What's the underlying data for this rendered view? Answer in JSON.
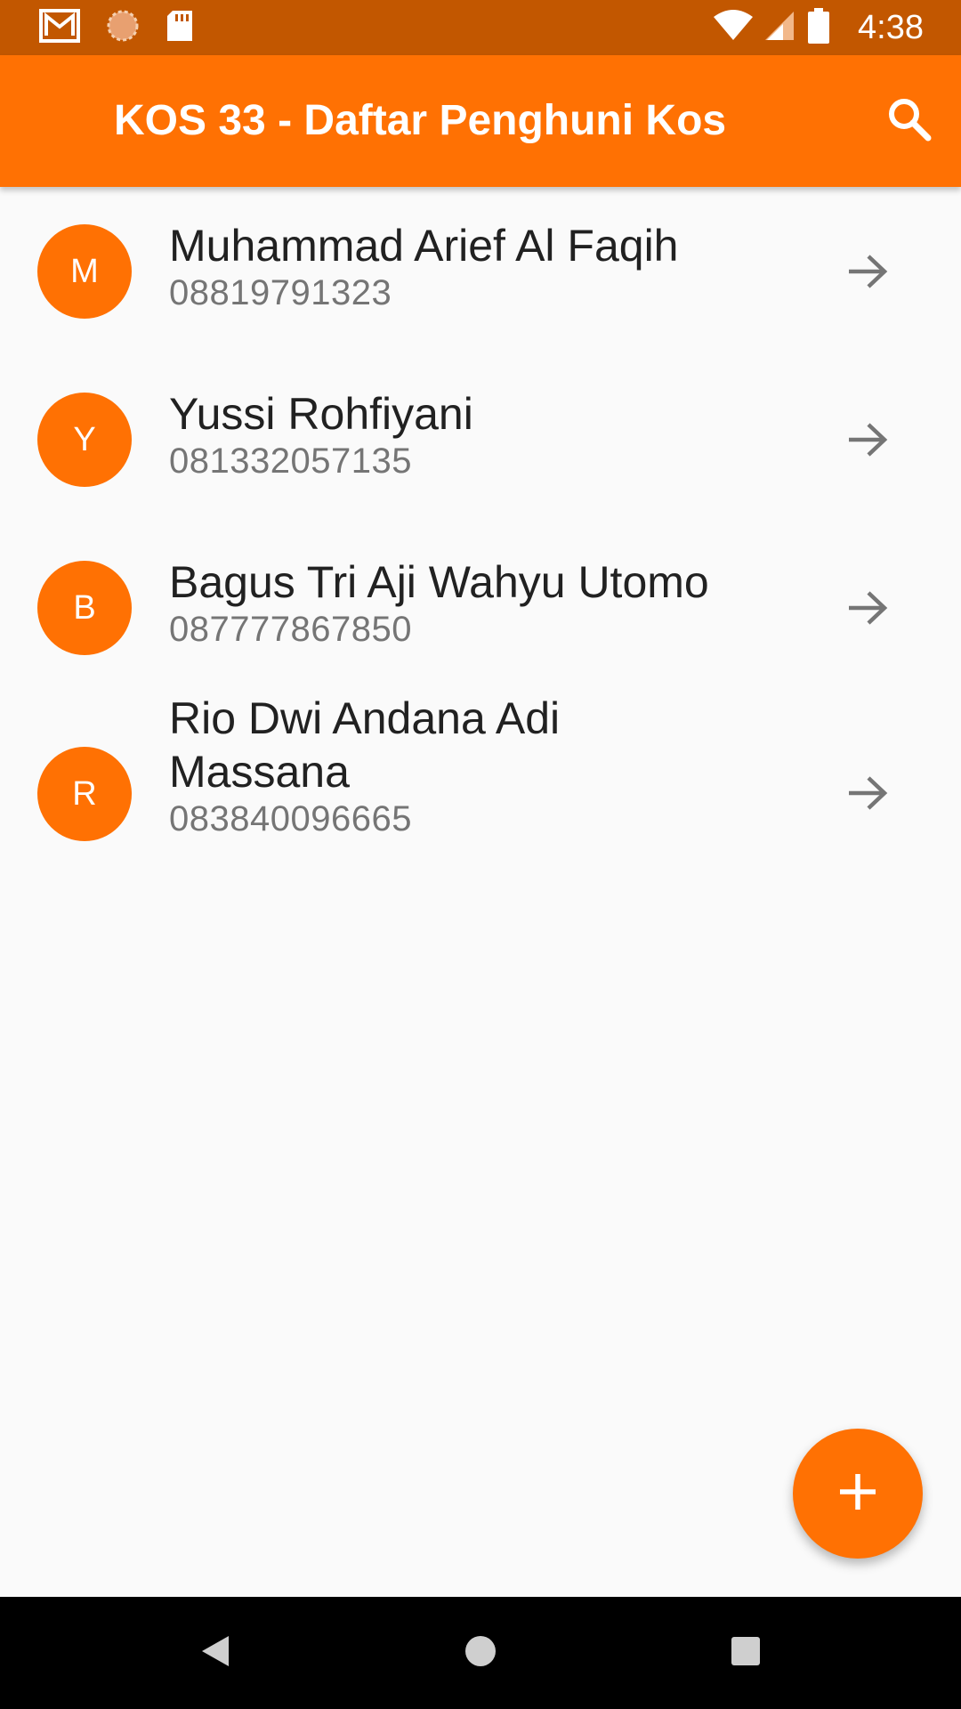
{
  "status_bar": {
    "time": "4:38",
    "left_icons": [
      "gmail-icon",
      "sync-icon",
      "sd-card-icon"
    ],
    "right_icons": [
      "wifi-icon",
      "signal-icon",
      "battery-icon"
    ]
  },
  "app_bar": {
    "title": "KOS 33 - Daftar Penghuni Kos",
    "search_icon": "search-icon"
  },
  "residents": [
    {
      "initial": "M",
      "name": "Muhammad Arief Al Faqih",
      "phone": "08819791323"
    },
    {
      "initial": "Y",
      "name": "Yussi Rohfiyani",
      "phone": "081332057135"
    },
    {
      "initial": "B",
      "name": "Bagus Tri Aji Wahyu Utomo",
      "phone": "087777867850"
    },
    {
      "initial": "R",
      "name": "Rio Dwi Andana Adi Massana",
      "phone": "083840096665"
    }
  ],
  "fab": {
    "icon": "plus-icon"
  },
  "nav_bar": {
    "buttons": [
      "back-icon",
      "home-icon",
      "recents-icon"
    ]
  },
  "colors": {
    "primary": "#ff7103",
    "status_bar": "#c25700",
    "background": "#fafafa",
    "name_text": "#212121",
    "phone_text": "#757575"
  }
}
